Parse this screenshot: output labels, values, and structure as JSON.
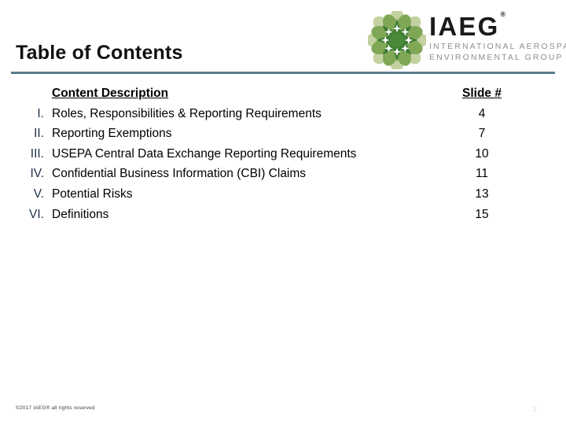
{
  "logo": {
    "emblem_icon": "iaeg-flower-emblem-icon",
    "wordmark": "IAEG",
    "registered_mark": "®",
    "subtitle_line1": "INTERNATIONAL AEROSPACE",
    "subtitle_line2": "ENVIRONMENTAL GROUP",
    "colors": {
      "emblem_center": "#4a8b3a",
      "emblem_inner": "#3f7d34",
      "emblem_mid": "#7fa755",
      "emblem_outer": "#c3d2a0",
      "wordmark": "#1a1a1a",
      "subtitle": "#8d8d8d"
    }
  },
  "title": "Table of Contents",
  "rule_color": "#5b7b8c",
  "table": {
    "headers": {
      "description": "Content Description",
      "slide": "Slide #"
    },
    "rows": [
      {
        "numeral": "I.",
        "description": "Roles, Responsibilities & Reporting Requirements",
        "slide": "4"
      },
      {
        "numeral": "II.",
        "description": "Reporting Exemptions",
        "slide": "7"
      },
      {
        "numeral": "III.",
        "description": "USEPA Central Data Exchange Reporting Requirements",
        "slide": "10"
      },
      {
        "numeral": "IV.",
        "description": "Confidential Business Information (CBI) Claims",
        "slide": "11"
      },
      {
        "numeral": "V.",
        "description": "Potential Risks",
        "slide": "13"
      },
      {
        "numeral": "VI.",
        "description": "Definitions",
        "slide": "15"
      }
    ]
  },
  "footer": {
    "copyright": "©2017 IAEG® all rights reserved",
    "slide_number": "3"
  }
}
